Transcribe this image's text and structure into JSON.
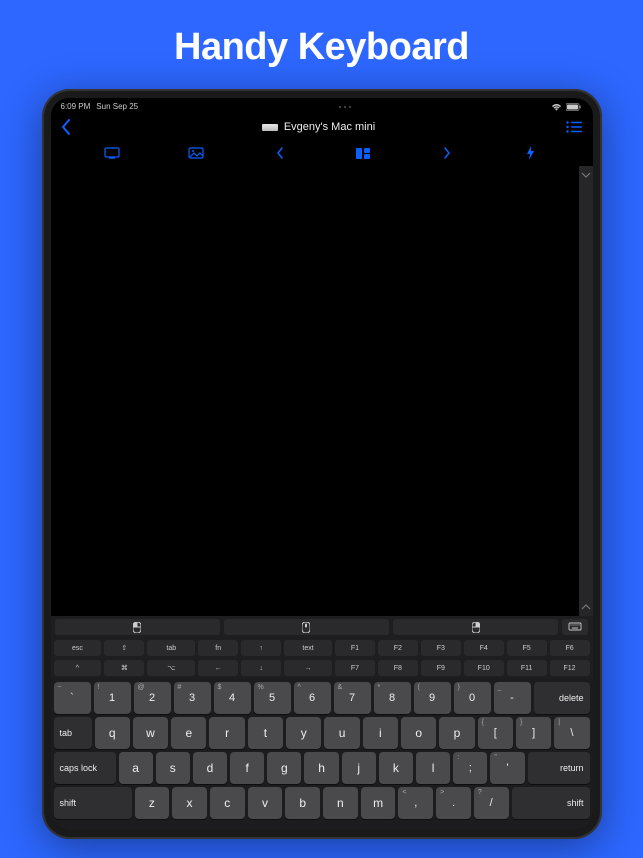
{
  "hero": {
    "title": "Handy Keyboard"
  },
  "status": {
    "time": "6:09 PM",
    "date": "Sun Sep 25"
  },
  "nav": {
    "device_name": "Evgeny's Mac mini"
  },
  "fnrow1": [
    "esc",
    "⇧",
    "tab",
    "fn",
    "↑",
    "text",
    "F1",
    "F2",
    "F3",
    "F4",
    "F5",
    "F6"
  ],
  "fnrow2": [
    "^",
    "⌘",
    "⌥",
    "←",
    "↓",
    "→",
    "F7",
    "F8",
    "F9",
    "F10",
    "F11",
    "F12"
  ],
  "numrow": [
    {
      "sub": "~",
      "main": "`"
    },
    {
      "sub": "!",
      "main": "1"
    },
    {
      "sub": "@",
      "main": "2"
    },
    {
      "sub": "#",
      "main": "3"
    },
    {
      "sub": "$",
      "main": "4"
    },
    {
      "sub": "%",
      "main": "5"
    },
    {
      "sub": "^",
      "main": "6"
    },
    {
      "sub": "&",
      "main": "7"
    },
    {
      "sub": "*",
      "main": "8"
    },
    {
      "sub": "(",
      "main": "9"
    },
    {
      "sub": ")",
      "main": "0"
    },
    {
      "sub": "_",
      "main": "-"
    }
  ],
  "keys": {
    "delete": "delete",
    "tab": "tab",
    "caps": "caps lock",
    "return": "return",
    "shift": "shift"
  },
  "row_q": [
    "q",
    "w",
    "e",
    "r",
    "t",
    "y",
    "u",
    "i",
    "o",
    "p"
  ],
  "row_q_tail": [
    {
      "sub": "{",
      "main": "["
    },
    {
      "sub": "}",
      "main": "]"
    },
    {
      "sub": "|",
      "main": "\\"
    }
  ],
  "row_a": [
    "a",
    "s",
    "d",
    "f",
    "g",
    "h",
    "j",
    "k",
    "l"
  ],
  "row_a_tail": [
    {
      "sub": ":",
      "main": ";"
    },
    {
      "sub": "\"",
      "main": "'"
    }
  ],
  "row_z": [
    "z",
    "x",
    "c",
    "v",
    "b",
    "n",
    "m"
  ],
  "row_z_tail": [
    {
      "sub": "<",
      "main": ","
    },
    {
      "sub": ">",
      "main": "."
    },
    {
      "sub": "?",
      "main": "/"
    }
  ]
}
